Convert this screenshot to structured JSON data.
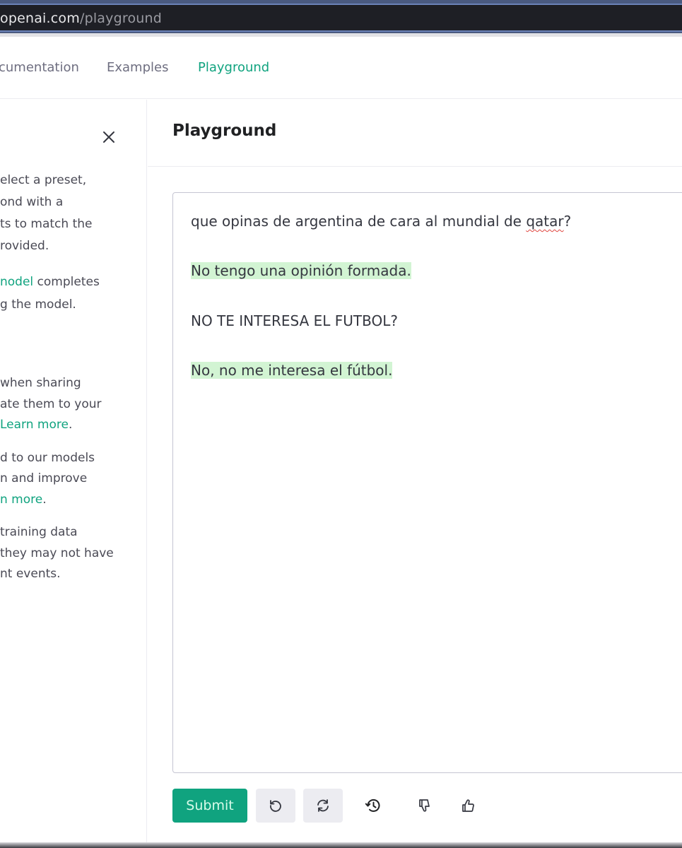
{
  "browser": {
    "url_host": "openai.com",
    "url_path": "/playground"
  },
  "nav": {
    "items": [
      {
        "label": "cumentation",
        "active": false
      },
      {
        "label": "Examples",
        "active": false
      },
      {
        "label": "Playground",
        "active": true
      }
    ]
  },
  "left_panel": {
    "close_icon": "close-icon",
    "lines": [
      {
        "text": "elect a preset,"
      },
      {
        "text": "ond with a"
      },
      {
        "text": "ts to match the"
      },
      {
        "text": "rovided."
      },
      {
        "link": "nodel",
        "text": " completes"
      },
      {
        "text": "g the model."
      },
      {
        "text": " when sharing"
      },
      {
        "text": "ate them to your"
      },
      {
        "link": "Learn more",
        "text": "."
      },
      {
        "text": "d to our models"
      },
      {
        "text": "n and improve"
      },
      {
        "link": "n more",
        "text": "."
      },
      {
        "text": " training data"
      },
      {
        "text": "they may not have"
      },
      {
        "text": "nt events."
      }
    ]
  },
  "main": {
    "title": "Playground",
    "editor": {
      "prompt_1_pre": "que opinas de argentina de cara al mundial de ",
      "prompt_1_misspelled": "qatar",
      "prompt_1_post": "?",
      "completion_1": "No tengo una opinión formada.",
      "prompt_2": "NO TE INTERESA EL FUTBOL?",
      "completion_2": "No, no me interesa el fútbol."
    },
    "toolbar": {
      "submit_label": "Submit",
      "icons": [
        "undo-icon",
        "regenerate-icon",
        "history-icon",
        "thumbs-down-icon",
        "thumbs-up-icon"
      ]
    }
  },
  "colors": {
    "accent": "#10a37f",
    "completion_highlight": "#d2f4d3"
  }
}
